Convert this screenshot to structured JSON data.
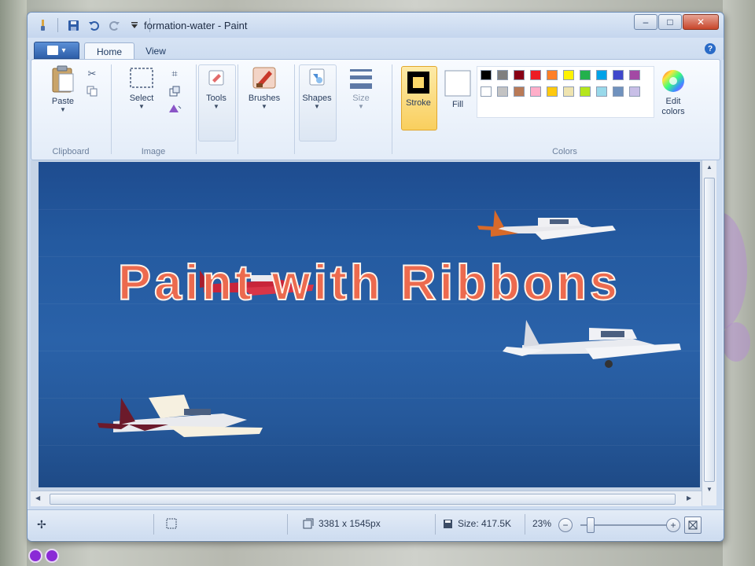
{
  "window": {
    "title": "formation-water - Paint",
    "controls": {
      "minimize": "–",
      "maximize": "□",
      "close": "✕"
    }
  },
  "qat": {
    "icons": [
      "paint-app-icon",
      "save-icon",
      "undo-icon",
      "redo-icon",
      "customize-icon"
    ]
  },
  "tabs": {
    "app_menu": "▾",
    "home": "Home",
    "view": "View",
    "help": "?"
  },
  "ribbon": {
    "clipboard": {
      "label": "Clipboard",
      "paste": "Paste"
    },
    "image": {
      "label": "Image",
      "select": "Select"
    },
    "tools": {
      "label": "Tools"
    },
    "brushes": {
      "label": "Brushes"
    },
    "shapes": {
      "label": "Shapes"
    },
    "size": {
      "label": "Size"
    },
    "stroke": {
      "label": "Stroke"
    },
    "fill": {
      "label": "Fill"
    },
    "colors": {
      "label": "Colors",
      "edit_colors": "Edit colors",
      "row1": [
        "#000000",
        "#7f7f7f",
        "#880015",
        "#ed1c24",
        "#ff7f27",
        "#fff200",
        "#22b14c",
        "#00a2e8",
        "#3f48cc",
        "#a349a4"
      ],
      "row2": [
        "#ffffff",
        "#c3c3c3",
        "#b97a57",
        "#ffaec9",
        "#ffc90e",
        "#efe4b0",
        "#b5e61d",
        "#99d9ea",
        "#7092be",
        "#c8bfe7"
      ]
    }
  },
  "canvas": {
    "overlay_title": "Paint with Ribbons"
  },
  "status": {
    "cursor_icon": "move-cross-icon",
    "selection_icon": "selection-size-icon",
    "dimensions": "3381 x 1545px",
    "size": "Size: 417.5K",
    "zoom": "23%",
    "zoom_level": 0.23,
    "zoom_out": "−",
    "zoom_in": "+"
  }
}
